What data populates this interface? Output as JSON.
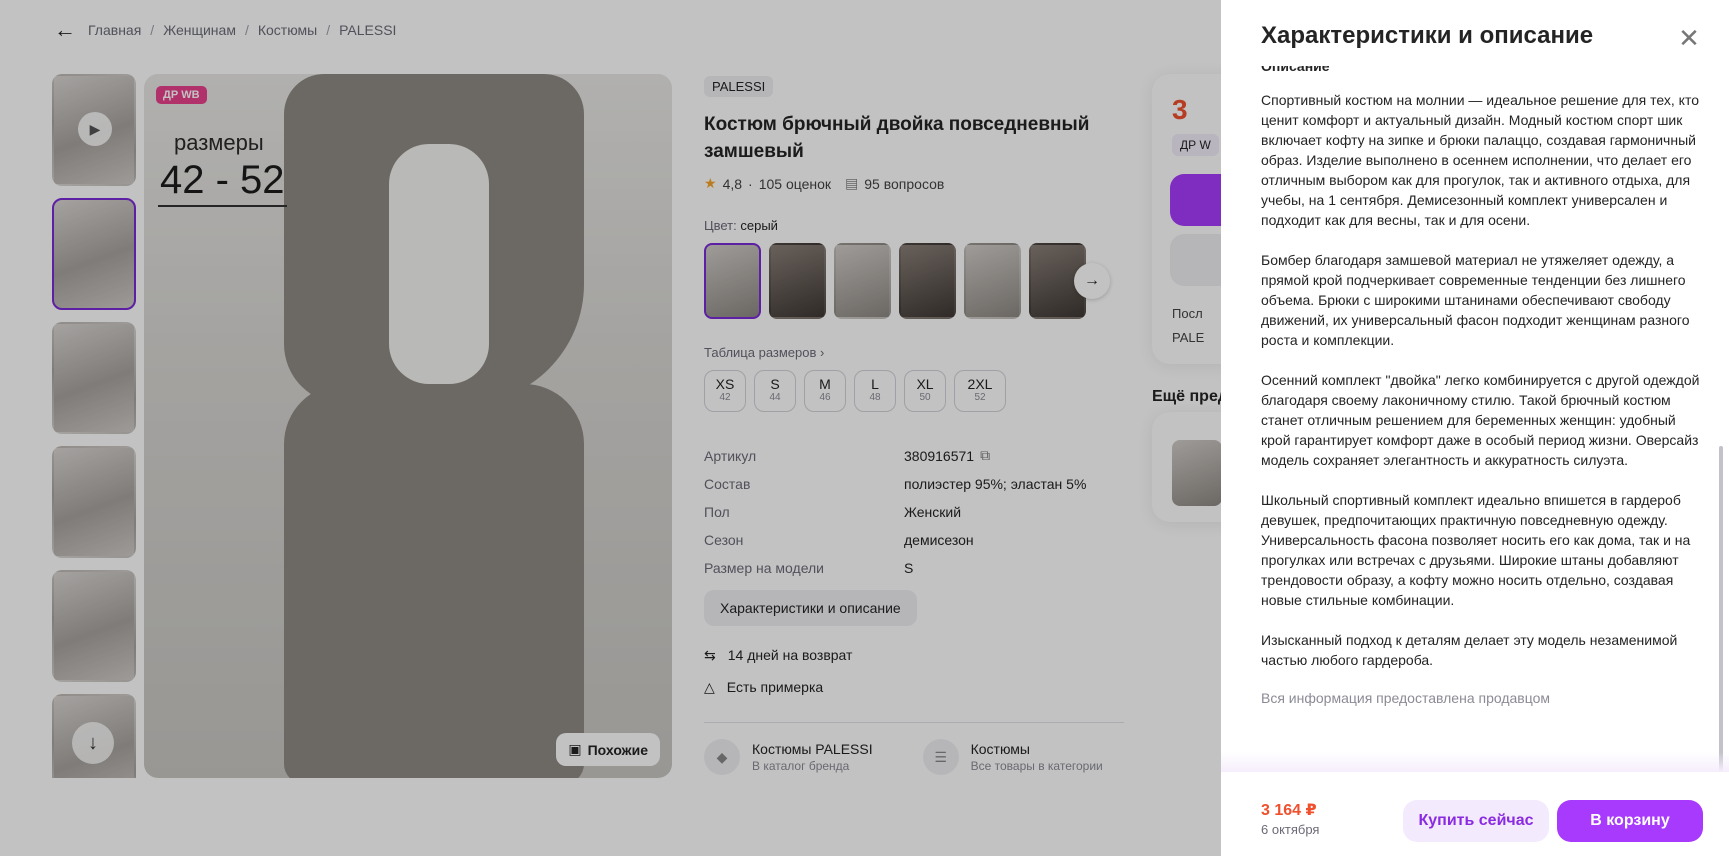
{
  "breadcrumbs": [
    "Главная",
    "Женщинам",
    "Костюмы",
    "PALESSI"
  ],
  "gallery": {
    "badge": "ДР WB",
    "size_caption": "размеры",
    "size_range": "42 - 52",
    "similar_label": "Похожие"
  },
  "product": {
    "brand": "PALESSI",
    "title": "Костюм брючный двойка повседневный замшевый",
    "rating": "4,8",
    "reviews": "105 оценок",
    "questions": "95 вопросов",
    "color_label": "Цвет:",
    "color_value": "серый",
    "size_table_label": "Таблица размеров",
    "sizes": [
      {
        "name": "XS",
        "ru": "42"
      },
      {
        "name": "S",
        "ru": "44"
      },
      {
        "name": "M",
        "ru": "46"
      },
      {
        "name": "L",
        "ru": "48"
      },
      {
        "name": "XL",
        "ru": "50"
      },
      {
        "name": "2XL",
        "ru": "52"
      }
    ],
    "specs": [
      {
        "key": "Артикул",
        "value": "380916571"
      },
      {
        "key": "Состав",
        "value": "полиэстер 95%; эластан 5%"
      },
      {
        "key": "Пол",
        "value": "Женский"
      },
      {
        "key": "Сезон",
        "value": "демисезон"
      },
      {
        "key": "Размер на модели",
        "value": "S"
      }
    ],
    "char_button": "Характеристики и описание",
    "return_text": "14 дней на возврат",
    "fitting_text": "Есть примерка",
    "brand_link": {
      "title": "Костюмы PALESSI",
      "sub": "В каталог бренда"
    },
    "category_link": {
      "title": "Костюмы",
      "sub": "Все товары в категории"
    }
  },
  "buy_card": {
    "price_partial": "3",
    "chip_partial": "ДР W",
    "row1": "Посл",
    "row2": "PALE"
  },
  "more_title": "Ещё пред",
  "drawer": {
    "title": "Характеристики и описание",
    "section_heading": "Описание",
    "paragraphs": [
      "Спортивный костюм на молнии — идеальное решение для тех, кто ценит комфорт и актуальный дизайн. Модный костюм спорт шик включает кофту на зипке и брюки палаццо, создавая гармоничный образ. Изделие выполнено в осеннем исполнении, что делает его отличным выбором как для прогулок, так и активного отдыха, для учебы, на 1 сентября. Демисезонный комплект универсален и подходит как для весны, так и для осени.",
      "Бомбер благодаря замшевой материал не утяжеляет одежду, а прямой крой подчеркивает современные тенденции без лишнего объема. Брюки с широкими штанинами обеспечивают свободу движений, их универсальный фасон подходит женщинам разного роста и комплекции.",
      "Осенний комплект \"двойка\" легко комбинируется с другой одеждой благодаря своему лаконичному стилю. Такой брючный костюм станет отличным решением для беременных женщин: удобный крой гарантирует комфорт даже в особый период жизни. Оверсайз модель сохраняет элегантность и аккуратность силуэта.",
      "Школьный спортивный комплект идеально впишется в гардероб девушек, предпочитающих практичную повседневную одежду. Универсальность фасона позволяет носить его как дома, так и на прогулках или встречах с друзьями. Широкие штаны добавляют трендовости образу, а кофту можно носить отдельно, создавая новые стильные комбинации.",
      "Изысканный подход к деталям делает эту модель незаменимой частью любого гардероба."
    ],
    "seller_note": "Вся информация предоставлена продавцом",
    "footer": {
      "price": "3 164 ₽",
      "date": "6 октября",
      "buy_now": "Купить сейчас",
      "add_to_cart": "В корзину"
    }
  },
  "colors": {
    "accent": "#a73afd",
    "price": "#f0502d",
    "selected_border": "#7b2bd8"
  }
}
